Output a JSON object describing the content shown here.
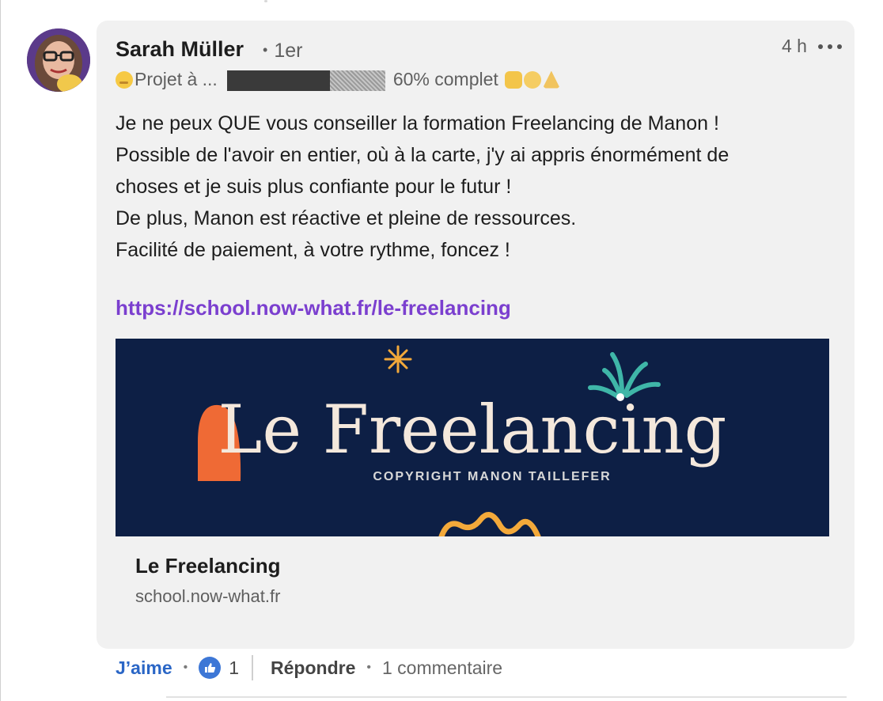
{
  "comment": {
    "author_name": "Sarah Müller",
    "degree": "1er",
    "headline_prefix": "Projet à ...",
    "headline_progress": "60% complet",
    "time": "4 h",
    "body_lines": [
      "Je ne peux QUE vous conseiller la formation Freelancing de Manon !",
      "Possible de l'avoir en entier, où à la carte, j'y ai appris énormément de",
      "choses et je suis plus confiante pour le futur !",
      "De plus, Manon est réactive et pleine de ressources.",
      "Facilité de paiement, à votre rythme, foncez !"
    ],
    "link": "https://school.now-what.fr/le-freelancing"
  },
  "preview": {
    "image_title": "Le Freelancing",
    "image_caption": "COPYRIGHT MANON TAILLEFER",
    "title": "Le Freelancing",
    "domain": "school.now-what.fr"
  },
  "actions": {
    "like_label": "J’aime",
    "like_count": "1",
    "reply_label": "Répondre",
    "comments_label": "1 commentaire"
  },
  "colors": {
    "link": "#7b3fcf",
    "like": "#2a66c6",
    "bubble": "#f1f1f1",
    "preview_bg": "#0d1f45"
  }
}
